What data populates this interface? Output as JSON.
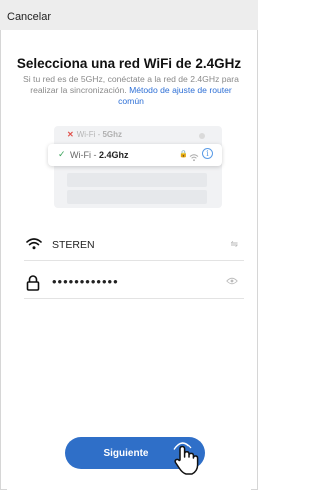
{
  "topbar": {
    "cancel_label": "Cancelar"
  },
  "header": {
    "title": "Selecciona una red WiFi de 2.4GHz",
    "subtitle": "Si tu red es de 5GHz, conéctate a la red de 2.4GHz para realizar la sincronización.",
    "link": "Método de ajuste de router común"
  },
  "illustration": {
    "network_5g_prefix": "Wi-Fi - ",
    "network_5g_band": "5Ghz",
    "network_24g_prefix": "Wi-Fi - ",
    "network_24g_band": "2.4Ghz",
    "info_glyph": "i"
  },
  "form": {
    "ssid_value": "STEREN",
    "password_value": "••••••••••••"
  },
  "actions": {
    "next_label": "Siguiente"
  },
  "colors": {
    "accent": "#2f6fc8",
    "check": "#3aa35a",
    "error": "#e0504a"
  },
  "icons": [
    "wifi-icon",
    "lock-icon",
    "swap-icon",
    "eye-icon",
    "check-icon",
    "close-icon",
    "info-icon",
    "hand-pointer-icon"
  ]
}
